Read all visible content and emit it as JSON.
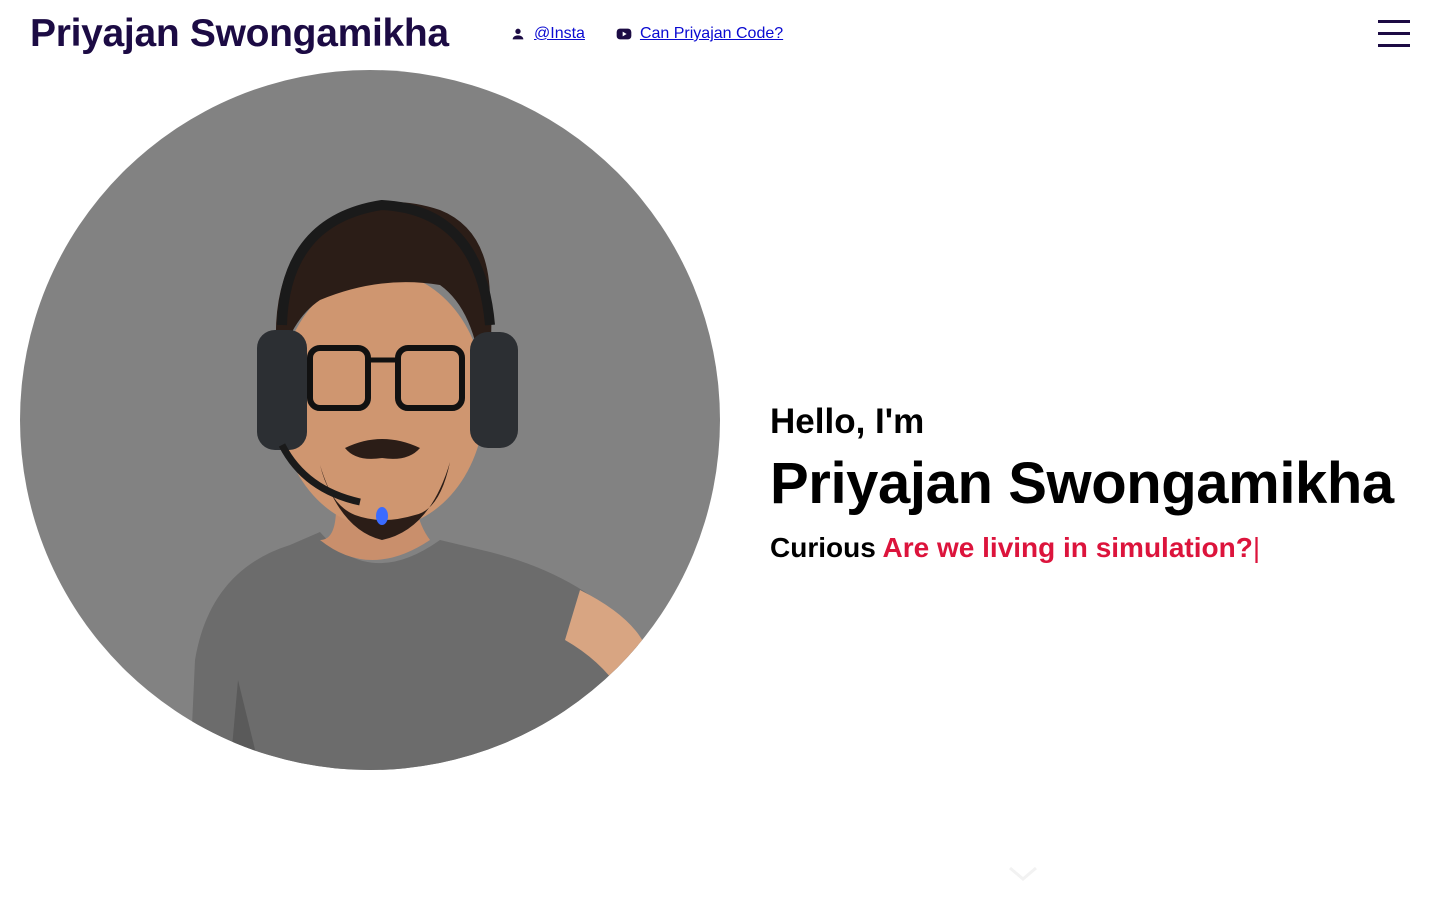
{
  "header": {
    "site_title": "Priyajan Swongamikha",
    "links": [
      {
        "label": "@Insta",
        "icon": "person-icon"
      },
      {
        "label": "Can Priyajan Code?",
        "icon": "youtube-icon"
      }
    ],
    "menu_icon": "hamburger-menu-icon"
  },
  "hero": {
    "greeting": "Hello, I'm",
    "name": "Priyajan Swongamikha",
    "tagline_prefix": "Curious",
    "tagline_typed": "Are we living in simulation?",
    "typing_cursor": "|",
    "scroll_icon": "chevron-down-icon"
  },
  "colors": {
    "title": "#1c0b44",
    "link": "#0a0ad1",
    "accent": "#dc143c",
    "avatar_bg": "#828282",
    "text": "#000000",
    "background": "#ffffff"
  }
}
